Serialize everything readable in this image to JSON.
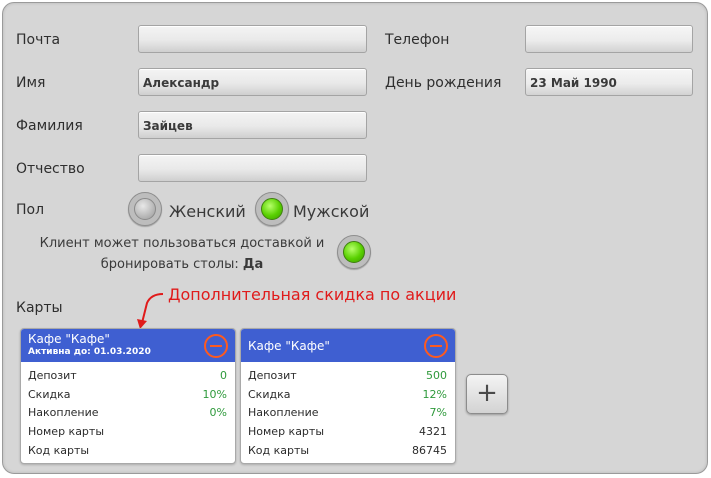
{
  "form": {
    "email_label": "Почта",
    "email_value": "",
    "phone_label": "Телефон",
    "phone_value": "",
    "first_name_label": "Имя",
    "first_name_value": "Александр",
    "birthday_label": "День рождения",
    "birthday_value": "23 Май 1990",
    "last_name_label": "Фамилия",
    "last_name_value": "Зайцев",
    "patronymic_label": "Отчество",
    "patronymic_value": "",
    "gender_label": "Пол",
    "gender_female": "Женский",
    "gender_male": "Мужской",
    "gender_selected": "Мужской",
    "delivery_note_line1": "Клиент может пользоваться доставкой и",
    "delivery_note_line2": "бронировать столы:",
    "delivery_value": "Да",
    "delivery_enabled": true
  },
  "cards_section": {
    "label": "Карты",
    "annotation": "Дополнительная скидка по акции",
    "annotation_color": "#e01b1b",
    "header_color": "#3f5fd1",
    "cards": [
      {
        "title": "Кафе \"Кафе\"",
        "subtitle": "Активна до: 01.03.2020",
        "rows": [
          {
            "label": "Депозит",
            "value": "0"
          },
          {
            "label": "Скидка",
            "value": "10%"
          },
          {
            "label": "Накопление",
            "value": "0%"
          },
          {
            "label": "Номер карты",
            "value": ""
          },
          {
            "label": "Код карты",
            "value": ""
          }
        ]
      },
      {
        "title": "Кафе \"Кафе\"",
        "subtitle": "",
        "rows": [
          {
            "label": "Депозит",
            "value": "500"
          },
          {
            "label": "Скидка",
            "value": "12%"
          },
          {
            "label": "Накопление",
            "value": "7%"
          },
          {
            "label": "Номер карты",
            "value": "4321"
          },
          {
            "label": "Код карты",
            "value": "86745"
          }
        ]
      }
    ],
    "add_button_label": "+"
  }
}
